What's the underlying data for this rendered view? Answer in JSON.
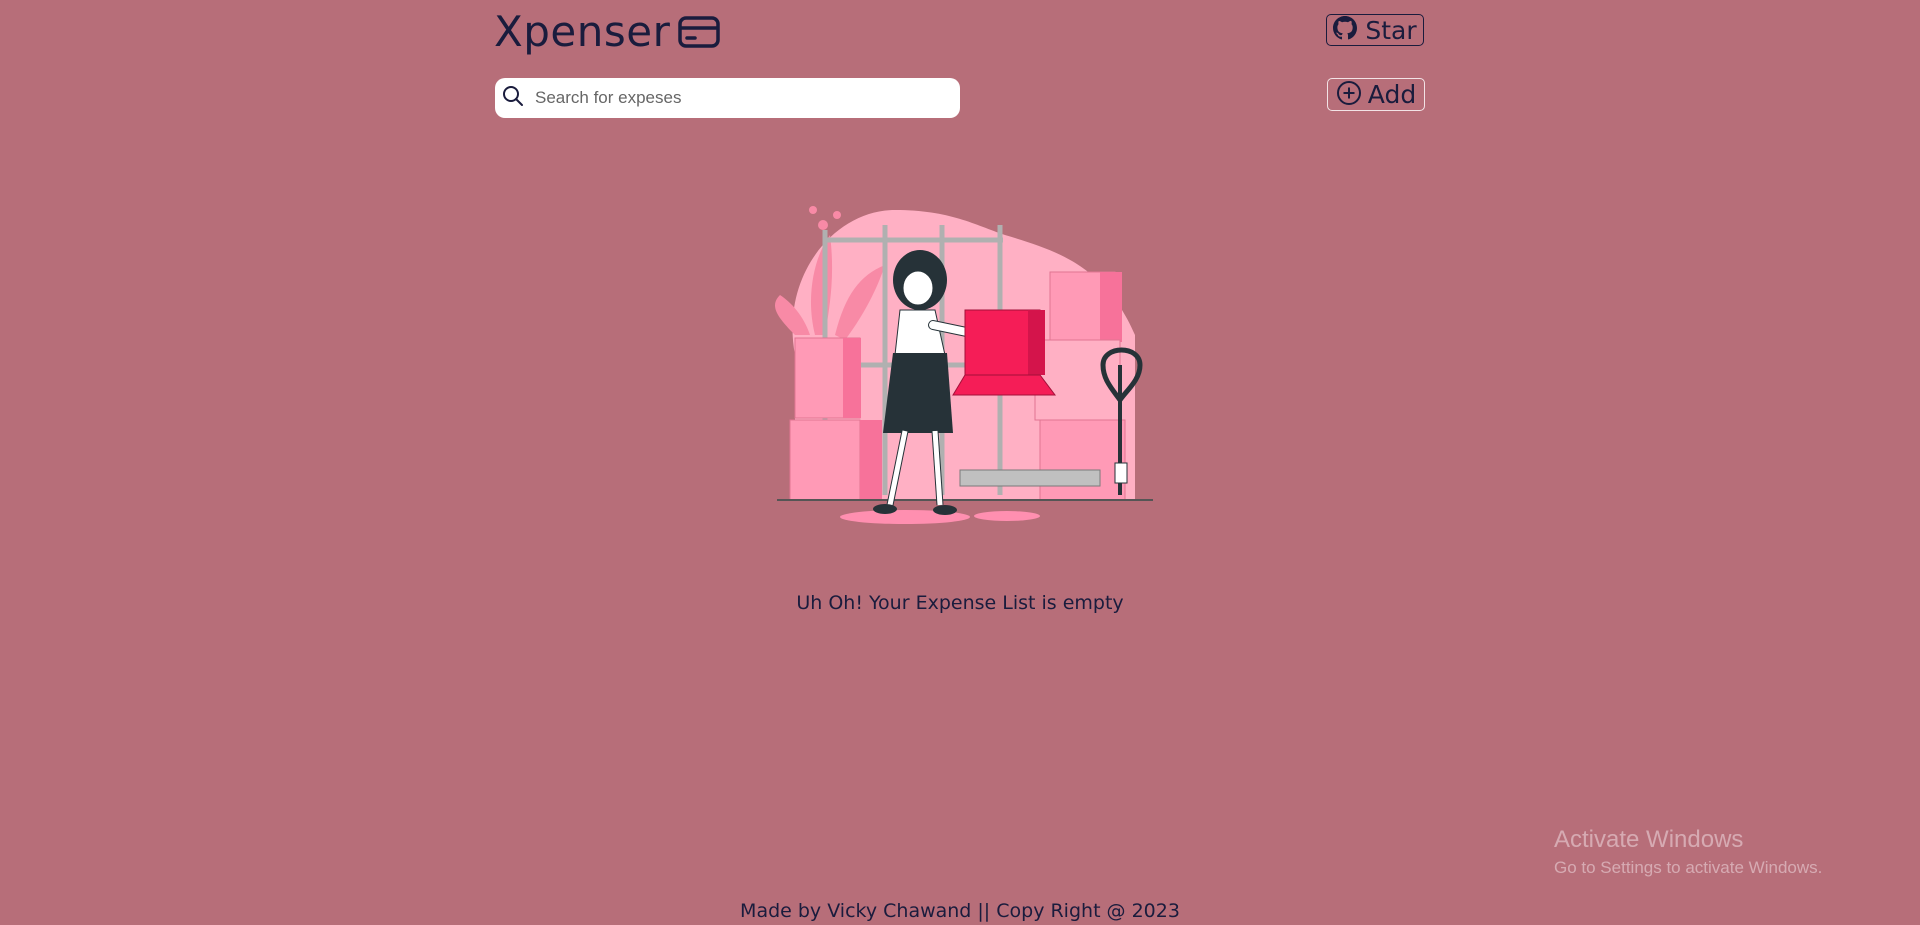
{
  "header": {
    "brand_title": "Xpenser",
    "brand_icon": "credit-card-icon",
    "star_label": "Star",
    "star_icon": "github-icon"
  },
  "search": {
    "placeholder": "Search for expeses",
    "value": "",
    "icon": "search-icon"
  },
  "actions": {
    "add_label": "Add",
    "add_icon": "plus-circle-icon"
  },
  "main": {
    "empty_message": "Uh Oh! Your Expense List is empty"
  },
  "footer": {
    "text": "Made by Vicky Chawand || Copy Right @ 2023"
  },
  "watermark": {
    "title": "Activate Windows",
    "subtitle": "Go to Settings to activate Windows."
  },
  "colors": {
    "background": "#b76e79",
    "text": "#1a1c3d",
    "accent_pink": "#f9306a"
  }
}
